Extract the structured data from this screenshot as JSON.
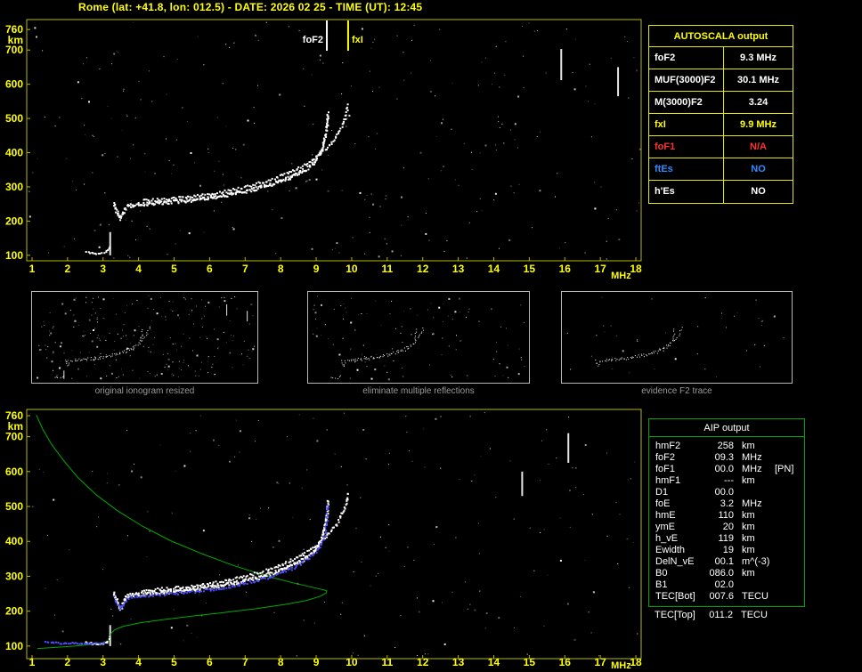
{
  "title": "Rome (lat: +41.8, lon: 012.5) - DATE: 2026 02 25 - TIME (UT): 12:45",
  "autoscala": {
    "header": "AUTOSCALA output",
    "rows": [
      {
        "label": "foF2",
        "value": "9.3 MHz",
        "color": "white"
      },
      {
        "label": "MUF(3000)F2",
        "value": "30.1 MHz",
        "color": "white"
      },
      {
        "label": "M(3000)F2",
        "value": "3.24",
        "color": "white"
      },
      {
        "label": "fxI",
        "value": "9.9 MHz",
        "color": "yellow"
      },
      {
        "label": "foF1",
        "value": "N/A",
        "color": "red"
      },
      {
        "label": "ftEs",
        "value": "NO",
        "color": "blue"
      },
      {
        "label": "h'Es",
        "value": "NO",
        "color": "white"
      }
    ]
  },
  "thumbnails": [
    {
      "caption": "original ionogram resized"
    },
    {
      "caption": "eliminate multiple reflections"
    },
    {
      "caption": "evidence F2 trace"
    }
  ],
  "aip": {
    "header": "AIP output",
    "rows": [
      {
        "label": "hmF2",
        "value": "258",
        "unit": "km",
        "note": ""
      },
      {
        "label": "foF2",
        "value": "09.3",
        "unit": "MHz",
        "note": ""
      },
      {
        "label": "foF1",
        "value": "00.0",
        "unit": "MHz",
        "note": "[PN]"
      },
      {
        "label": "hmF1",
        "value": "---",
        "unit": "km",
        "note": ""
      },
      {
        "label": "D1",
        "value": "00.0",
        "unit": "",
        "note": ""
      },
      {
        "label": "foE",
        "value": "3.2",
        "unit": "MHz",
        "note": ""
      },
      {
        "label": "hmE",
        "value": "110",
        "unit": "km",
        "note": ""
      },
      {
        "label": "ymE",
        "value": "20",
        "unit": "km",
        "note": ""
      },
      {
        "label": "h_vE",
        "value": "119",
        "unit": "km",
        "note": ""
      },
      {
        "label": "Ewidth",
        "value": "19",
        "unit": "km",
        "note": ""
      },
      {
        "label": "DelN_vE",
        "value": "00.1",
        "unit": "m^(-3)",
        "note": ""
      },
      {
        "label": "B0",
        "value": "086.0",
        "unit": "km",
        "note": ""
      },
      {
        "label": "B1",
        "value": "02.0",
        "unit": "",
        "note": ""
      },
      {
        "label": "TEC[Bot]",
        "value": "007.6",
        "unit": "TECU",
        "note": ""
      }
    ],
    "footer": {
      "label": "TEC[Top]",
      "value": "011.2",
      "unit": "TECU",
      "note": ""
    }
  },
  "colors": {
    "accent_yellow": "#ffff00",
    "axis_border": "#b9b900",
    "trace_white": "#ffffff",
    "fitted_blue": "#4d4dff",
    "profile_green": "#00b400",
    "na_red": "#ff3232",
    "es_blue": "#2e8bff",
    "caption_gray": "#9a9a9a"
  },
  "chart_data": [
    {
      "name": "autoscaled ionogram",
      "type": "scatter",
      "xlabel": "MHz",
      "ylabel": "km",
      "x_range": [
        0.85,
        18.15
      ],
      "y_range": [
        84,
        789
      ],
      "x_ticks": [
        1,
        2,
        3,
        4,
        5,
        6,
        7,
        8,
        9,
        10,
        11,
        12,
        13,
        14,
        15,
        16,
        17,
        18
      ],
      "y_ticks": [
        760,
        700,
        600,
        500,
        400,
        300,
        200,
        100
      ],
      "markers": [
        {
          "label": "foF2",
          "f": 9.3,
          "color": "#ffffff",
          "side": "left"
        },
        {
          "label": "fxI",
          "f": 9.9,
          "color": "#ffff00",
          "side": "right"
        }
      ],
      "series": [
        {
          "name": "F2 ordinary trace",
          "color": "#ffffff",
          "mode": "scatter",
          "size": 2,
          "dots": 2,
          "jitter": 2,
          "points": [
            [
              3.28,
              252
            ],
            [
              3.34,
              238
            ],
            [
              3.4,
              222
            ],
            [
              3.46,
              210
            ],
            [
              3.52,
              220
            ],
            [
              3.58,
              236
            ],
            [
              3.66,
              246
            ],
            [
              3.8,
              249
            ],
            [
              4.0,
              251
            ],
            [
              4.3,
              253
            ],
            [
              4.6,
              256
            ],
            [
              5.0,
              259
            ],
            [
              5.4,
              263
            ],
            [
              5.8,
              268
            ],
            [
              6.2,
              274
            ],
            [
              6.6,
              281
            ],
            [
              7.0,
              290
            ],
            [
              7.4,
              300
            ],
            [
              7.8,
              312
            ],
            [
              8.1,
              323
            ],
            [
              8.4,
              337
            ],
            [
              8.7,
              355
            ],
            [
              8.9,
              372
            ],
            [
              9.05,
              392
            ],
            [
              9.15,
              414
            ],
            [
              9.22,
              440
            ],
            [
              9.27,
              468
            ],
            [
              9.3,
              500
            ],
            [
              9.31,
              522
            ]
          ]
        },
        {
          "name": "F2 extraordinary trace",
          "color": "#ffffff",
          "mode": "scatter",
          "size": 2,
          "dots": 1,
          "jitter": 1.5,
          "points": [
            [
              4.1,
              262
            ],
            [
              4.5,
              265
            ],
            [
              4.9,
              268
            ],
            [
              5.3,
              272
            ],
            [
              5.7,
              277
            ],
            [
              6.1,
              283
            ],
            [
              6.5,
              291
            ],
            [
              6.9,
              300
            ],
            [
              7.3,
              311
            ],
            [
              7.7,
              324
            ],
            [
              8.1,
              339
            ],
            [
              8.5,
              358
            ],
            [
              8.85,
              380
            ],
            [
              9.15,
              404
            ],
            [
              9.4,
              430
            ],
            [
              9.6,
              458
            ],
            [
              9.75,
              488
            ],
            [
              9.84,
              520
            ],
            [
              9.87,
              545
            ]
          ]
        },
        {
          "name": "E region echoes",
          "color": "#ffffff",
          "mode": "scatter",
          "size": 2,
          "dots": 1,
          "jitter": 1,
          "points": [
            [
              2.5,
              113
            ],
            [
              2.7,
              109
            ],
            [
              2.9,
              108
            ],
            [
              3.05,
              112
            ],
            [
              3.15,
              120
            ],
            [
              3.2,
              132
            ]
          ]
        }
      ],
      "artifacts": [
        [
          3.2,
          100,
          168
        ],
        [
          15.9,
          612,
          703
        ],
        [
          17.5,
          565,
          650
        ]
      ],
      "noise_dots": 300
    },
    {
      "name": "ionogram with adjusted profile (AIP)",
      "type": "scatter",
      "xlabel": "MHz",
      "ylabel": "km",
      "x_range": [
        0.85,
        18.15
      ],
      "y_range": [
        64,
        778
      ],
      "x_ticks": [
        1,
        2,
        3,
        4,
        5,
        6,
        7,
        8,
        9,
        10,
        11,
        12,
        13,
        14,
        15,
        16,
        17,
        18
      ],
      "y_ticks": [
        760,
        700,
        600,
        500,
        400,
        300,
        200,
        100
      ],
      "markers": [],
      "series": [
        {
          "name": "electron density profile",
          "color": "#00b400",
          "mode": "line",
          "width": 1,
          "points": [
            [
              1.12,
              762
            ],
            [
              1.3,
              722
            ],
            [
              1.55,
              678
            ],
            [
              1.9,
              630
            ],
            [
              2.3,
              582
            ],
            [
              2.8,
              534
            ],
            [
              3.4,
              488
            ],
            [
              4.1,
              444
            ],
            [
              4.9,
              402
            ],
            [
              5.8,
              364
            ],
            [
              6.7,
              330
            ],
            [
              7.6,
              301
            ],
            [
              8.4,
              280
            ],
            [
              9.0,
              266
            ],
            [
              9.25,
              260
            ],
            [
              9.3,
              258
            ],
            [
              9.28,
              252
            ],
            [
              9.1,
              242
            ],
            [
              8.7,
              230
            ],
            [
              8.1,
              219
            ],
            [
              7.3,
              207
            ],
            [
              6.4,
              196
            ],
            [
              5.5,
              186
            ],
            [
              4.7,
              176
            ],
            [
              4.0,
              166
            ],
            [
              3.55,
              156
            ],
            [
              3.32,
              146
            ],
            [
              3.22,
              136
            ],
            [
              3.2,
              126
            ],
            [
              3.2,
              119
            ],
            [
              3.15,
              114
            ],
            [
              3.0,
              110
            ],
            [
              2.7,
              105
            ],
            [
              2.2,
              100
            ],
            [
              1.6,
              96
            ],
            [
              1.15,
              93
            ]
          ]
        },
        {
          "name": "F2 ordinary trace",
          "color": "#ffffff",
          "mode": "scatter",
          "size": 2,
          "dots": 2,
          "jitter": 2,
          "points": [
            [
              3.28,
              252
            ],
            [
              3.34,
              238
            ],
            [
              3.4,
              222
            ],
            [
              3.46,
              210
            ],
            [
              3.52,
              220
            ],
            [
              3.58,
              236
            ],
            [
              3.66,
              246
            ],
            [
              3.8,
              249
            ],
            [
              4.0,
              251
            ],
            [
              4.3,
              253
            ],
            [
              4.6,
              256
            ],
            [
              5.0,
              259
            ],
            [
              5.4,
              263
            ],
            [
              5.8,
              268
            ],
            [
              6.2,
              274
            ],
            [
              6.6,
              281
            ],
            [
              7.0,
              290
            ],
            [
              7.4,
              300
            ],
            [
              7.8,
              312
            ],
            [
              8.1,
              323
            ],
            [
              8.4,
              337
            ],
            [
              8.7,
              355
            ],
            [
              8.9,
              372
            ],
            [
              9.05,
              392
            ],
            [
              9.15,
              414
            ],
            [
              9.22,
              440
            ],
            [
              9.27,
              468
            ],
            [
              9.3,
              500
            ],
            [
              9.31,
              522
            ]
          ]
        },
        {
          "name": "F2 extraordinary trace",
          "color": "#ffffff",
          "mode": "scatter",
          "size": 2,
          "dots": 1,
          "jitter": 1.5,
          "points": [
            [
              4.1,
              262
            ],
            [
              4.5,
              265
            ],
            [
              4.9,
              268
            ],
            [
              5.3,
              272
            ],
            [
              5.7,
              277
            ],
            [
              6.1,
              283
            ],
            [
              6.5,
              291
            ],
            [
              6.9,
              300
            ],
            [
              7.3,
              311
            ],
            [
              7.7,
              324
            ],
            [
              8.1,
              339
            ],
            [
              8.5,
              358
            ],
            [
              8.85,
              380
            ],
            [
              9.15,
              404
            ],
            [
              9.4,
              430
            ],
            [
              9.6,
              458
            ],
            [
              9.75,
              488
            ],
            [
              9.84,
              520
            ],
            [
              9.87,
              545
            ]
          ]
        },
        {
          "name": "E region echoes",
          "color": "#ffffff",
          "mode": "scatter",
          "size": 2,
          "dots": 1,
          "jitter": 1,
          "points": [
            [
              2.5,
              113
            ],
            [
              2.7,
              109
            ],
            [
              2.9,
              108
            ],
            [
              3.05,
              112
            ],
            [
              3.15,
              120
            ],
            [
              3.2,
              132
            ]
          ]
        },
        {
          "name": "Autoscala fitted trace",
          "color": "#4d4dff",
          "mode": "scatter",
          "size": 2,
          "dots": 1,
          "jitter": 1.5,
          "points": [
            [
              3.3,
              242
            ],
            [
              3.38,
              222
            ],
            [
              3.46,
              208
            ],
            [
              3.54,
              218
            ],
            [
              3.62,
              234
            ],
            [
              3.8,
              243
            ],
            [
              4.1,
              246
            ],
            [
              4.5,
              249
            ],
            [
              5.0,
              253
            ],
            [
              5.5,
              258
            ],
            [
              6.0,
              264
            ],
            [
              6.5,
              272
            ],
            [
              7.0,
              282
            ],
            [
              7.5,
              295
            ],
            [
              8.0,
              311
            ],
            [
              8.4,
              330
            ],
            [
              8.75,
              352
            ],
            [
              9.0,
              376
            ],
            [
              9.15,
              400
            ],
            [
              9.24,
              430
            ],
            [
              9.28,
              462
            ],
            [
              9.3,
              495
            ],
            [
              9.31,
              510
            ]
          ]
        },
        {
          "name": "fitted E trace",
          "color": "#4d4dff",
          "mode": "scatter",
          "size": 2,
          "dots": 1,
          "jitter": 1,
          "points": [
            [
              1.35,
              113
            ],
            [
              1.7,
              111
            ],
            [
              2.1,
              110
            ],
            [
              2.5,
              109
            ],
            [
              2.85,
              110
            ],
            [
              3.05,
              112
            ]
          ]
        }
      ],
      "artifacts": [
        [
          3.2,
          100,
          160
        ],
        [
          16.1,
          625,
          710
        ],
        [
          14.8,
          530,
          600
        ]
      ],
      "noise_dots": 210
    }
  ]
}
